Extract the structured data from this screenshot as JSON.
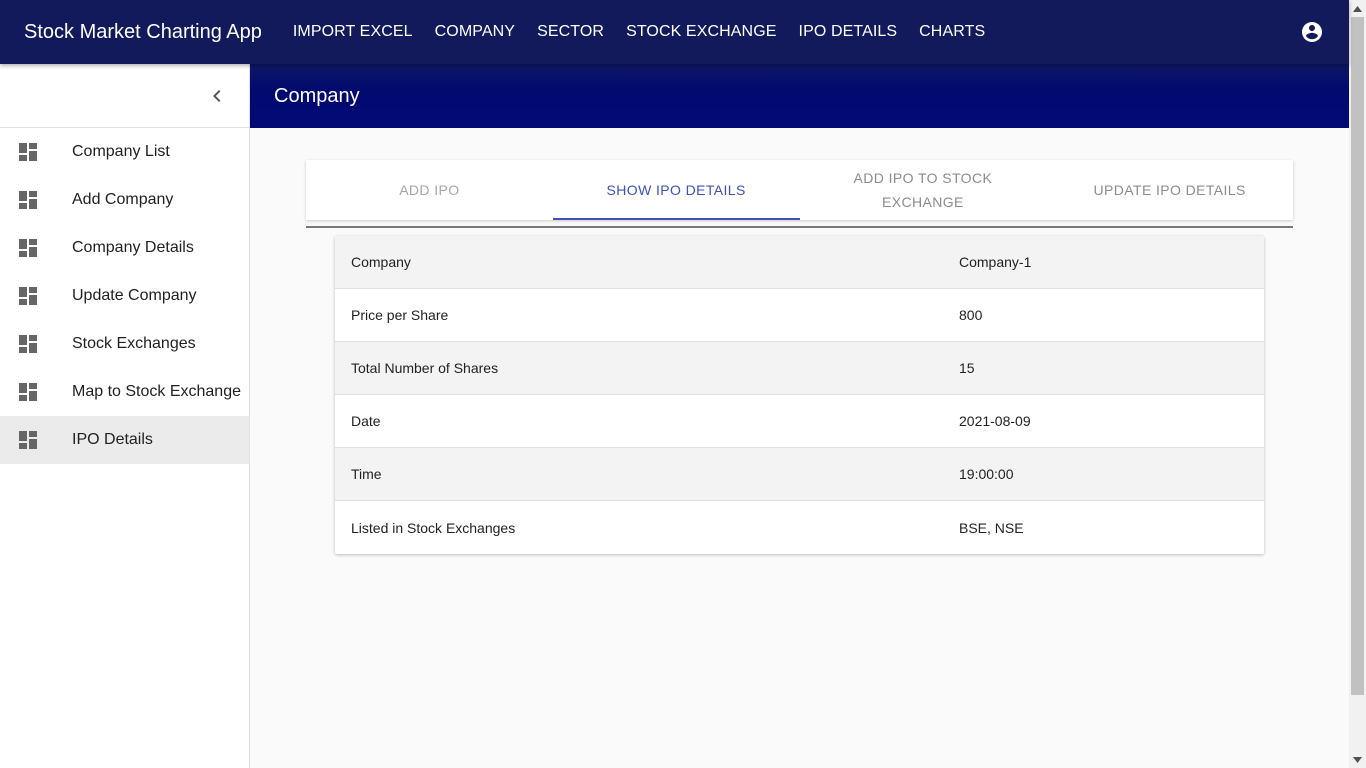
{
  "app": {
    "title": "Stock Market Charting App",
    "nav": [
      "IMPORT EXCEL",
      "COMPANY",
      "SECTOR",
      "STOCK EXCHANGE",
      "IPO DETAILS",
      "CHARTS"
    ],
    "account_icon": "account-circle-icon"
  },
  "sidebar": {
    "collapse_icon": "chevron-left-icon",
    "items": [
      {
        "label": "Company List",
        "icon": "dashboard-icon"
      },
      {
        "label": "Add Company",
        "icon": "dashboard-icon"
      },
      {
        "label": "Company Details",
        "icon": "dashboard-icon"
      },
      {
        "label": "Update Company",
        "icon": "dashboard-icon"
      },
      {
        "label": "Stock Exchanges",
        "icon": "dashboard-icon"
      },
      {
        "label": "Map to Stock Exchange",
        "icon": "dashboard-icon"
      },
      {
        "label": "IPO Details",
        "icon": "dashboard-icon",
        "active": true
      }
    ]
  },
  "page": {
    "title": "Company"
  },
  "tabs": [
    {
      "label": "ADD IPO"
    },
    {
      "label": "SHOW IPO DETAILS",
      "active": true
    },
    {
      "label": "ADD IPO TO STOCK EXCHANGE"
    },
    {
      "label": "UPDATE IPO DETAILS"
    }
  ],
  "details": [
    {
      "key": "Company",
      "value": "Company-1"
    },
    {
      "key": "Price per Share",
      "value": "800"
    },
    {
      "key": "Total Number of Shares",
      "value": "15"
    },
    {
      "key": "Date",
      "value": "2021-08-09"
    },
    {
      "key": "Time",
      "value": "19:00:00"
    },
    {
      "key": "Listed in Stock Exchanges",
      "value": "BSE, NSE"
    }
  ],
  "colors": {
    "appbar": "#131a5c",
    "header": "#010a6e",
    "tab_active": "#3f51b5"
  }
}
